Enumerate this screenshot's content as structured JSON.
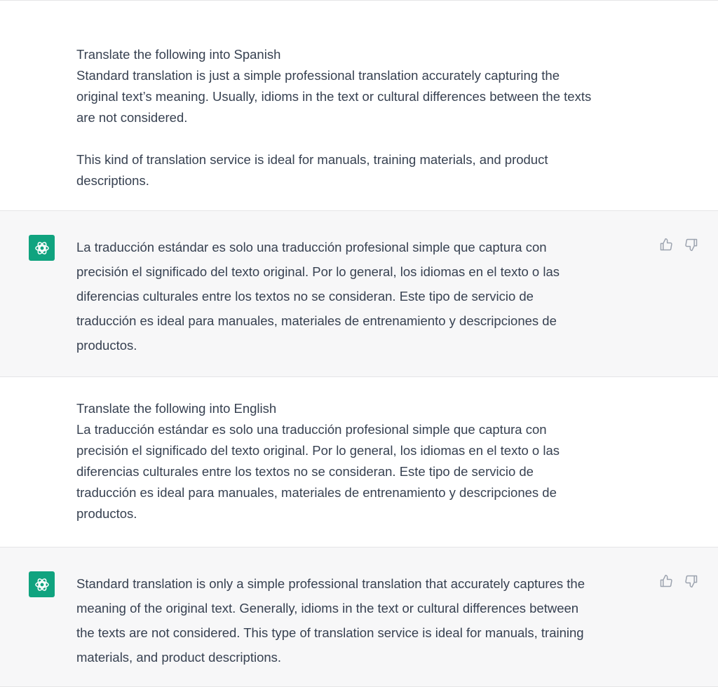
{
  "colors": {
    "assistant_bg": "#f7f7f8",
    "user_bg": "#ffffff",
    "avatar_bg": "#10a37f",
    "text": "#374151",
    "icon": "#9ca3af"
  },
  "messages": [
    {
      "role": "user",
      "text": "Translate the following into Spanish\nStandard translation is just a simple professional translation accurately capturing the\noriginal text’s meaning. Usually, idioms in the text or cultural differences between the texts\nare not considered.\n\nThis kind of translation service is ideal for manuals, training materials, and product\ndescriptions."
    },
    {
      "role": "assistant",
      "avatar_icon": "openai-logo-icon",
      "text": "La traducción estándar es solo una traducción profesional simple que captura con\nprecisión el significado del texto original. Por lo general, los idiomas en el texto o las\ndiferencias culturales entre los textos no se consideran. Este tipo de servicio de\ntraducción es ideal para manuales, materiales de entrenamiento y descripciones de\nproductos.",
      "actions": [
        "thumbs-up-icon",
        "thumbs-down-icon"
      ]
    },
    {
      "role": "user",
      "text": "Translate the following into English\nLa traducción estándar es solo una traducción profesional simple que captura con\nprecisión el significado del texto original. Por lo general, los idiomas en el texto o las\ndiferencias culturales entre los textos no se consideran. Este tipo de servicio de\ntraducción es ideal para manuales, materiales de entrenamiento y descripciones de\nproductos."
    },
    {
      "role": "assistant",
      "avatar_icon": "openai-logo-icon",
      "text": "Standard translation is only a simple professional translation that accurately captures the\nmeaning of the original text. Generally, idioms in the text or cultural differences between\nthe texts are not considered. This type of translation service is ideal for manuals, training\nmaterials, and product descriptions.",
      "actions": [
        "thumbs-up-icon",
        "thumbs-down-icon"
      ]
    }
  ]
}
